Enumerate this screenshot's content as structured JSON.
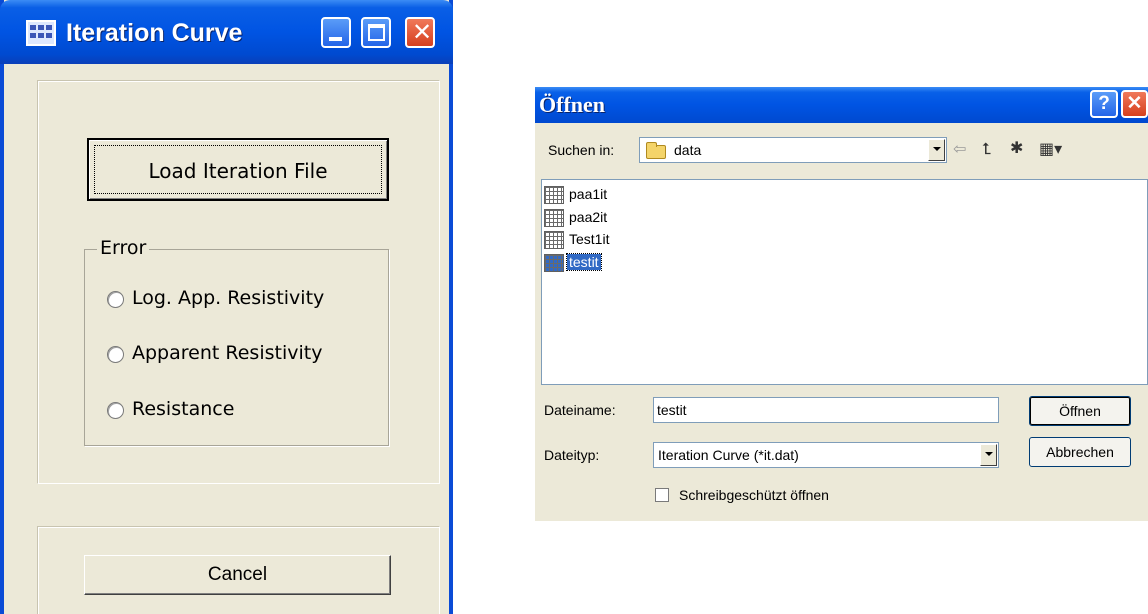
{
  "iteration_window": {
    "title": "Iteration Curve",
    "load_button": "Load Iteration File",
    "error_group": {
      "label": "Error",
      "options": [
        "Log. App. Resistivity",
        "Apparent Resistivity",
        "Resistance"
      ]
    },
    "cancel_button": "Cancel"
  },
  "open_dialog": {
    "title": "Öffnen",
    "look_in_label": "Suchen in:",
    "look_in_value": "data",
    "files": [
      "paa1it",
      "paa2it",
      "Test1it",
      "testit"
    ],
    "selected_file": "testit",
    "filename_label": "Dateiname:",
    "filename_value": "testit",
    "filetype_label": "Dateityp:",
    "filetype_value": "Iteration Curve (*it.dat)",
    "open_button": "Öffnen",
    "cancel_button": "Abbrechen",
    "readonly_label": "Schreibgeschützt öffnen"
  },
  "colors": {
    "titlebar_blue": "#0054e3",
    "window_face": "#ece9d8",
    "selection": "#316ac5",
    "close_red": "#d6401e"
  }
}
